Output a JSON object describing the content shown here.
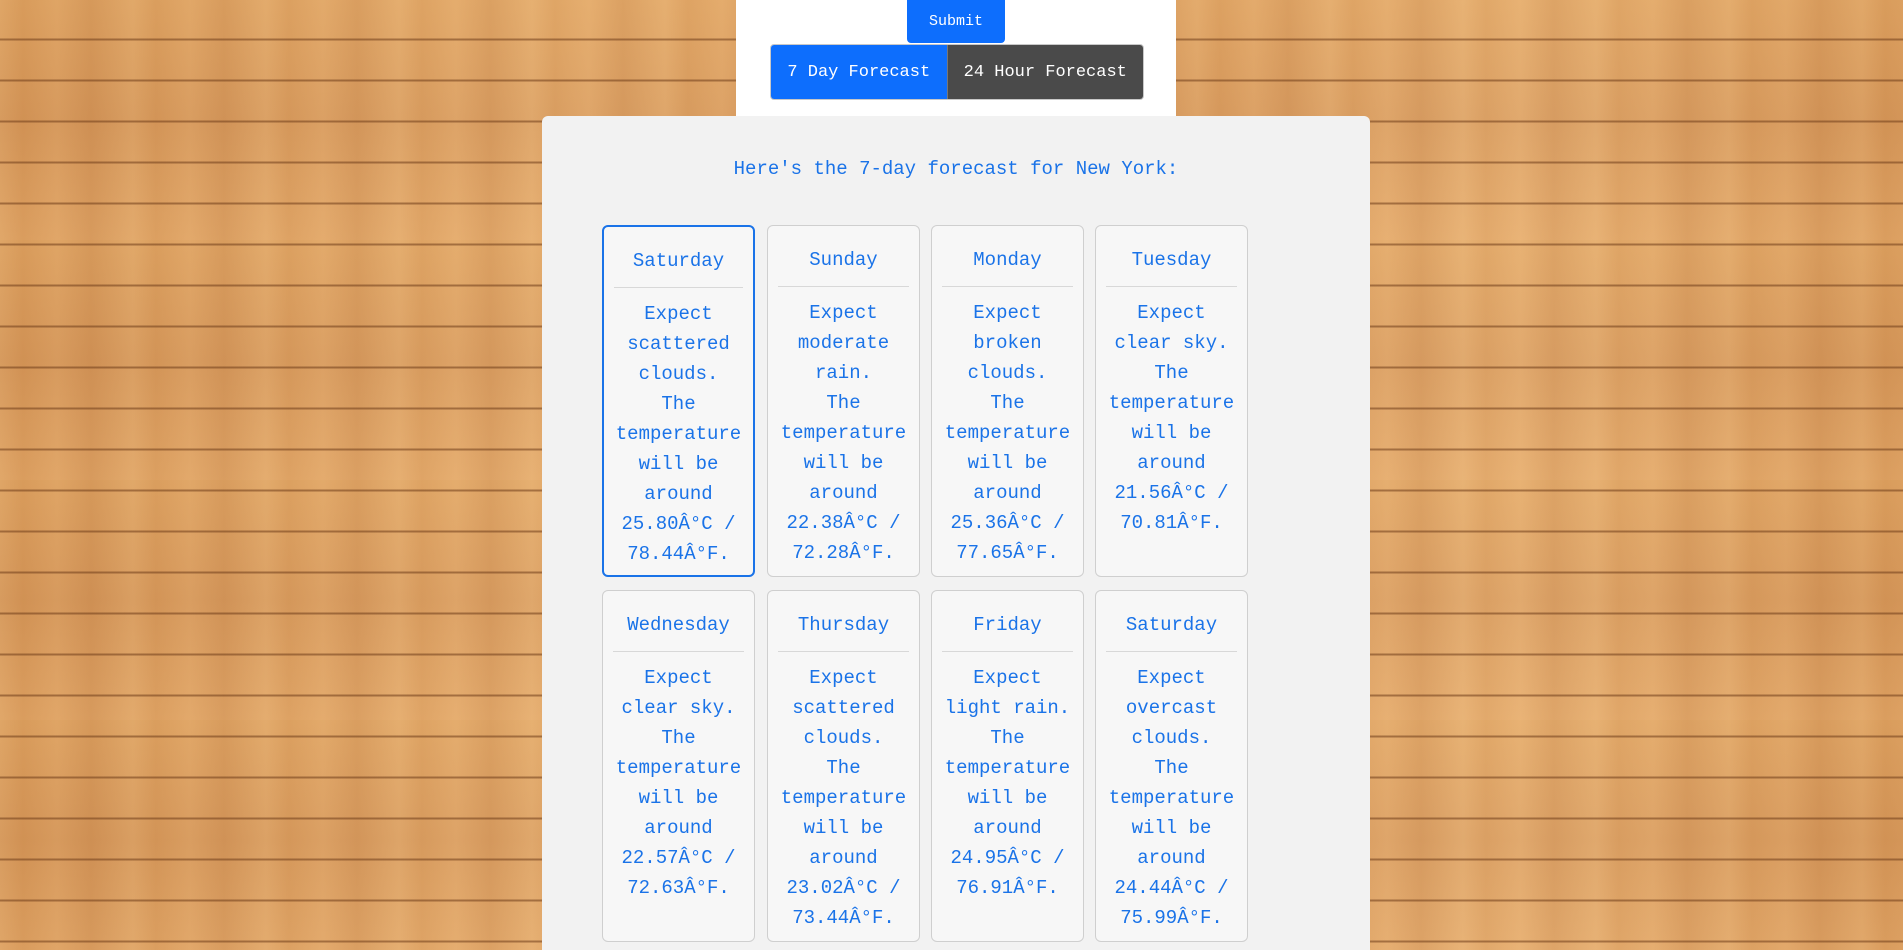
{
  "form": {
    "submit_label": "Submit"
  },
  "tabs": [
    {
      "label": "7 Day Forecast",
      "active": true
    },
    {
      "label": "24 Hour Forecast",
      "active": false
    }
  ],
  "forecast": {
    "heading": "Here's the 7-day forecast for New York:",
    "days": [
      {
        "day": "Saturday",
        "lines": [
          "Expect",
          "scattered",
          "clouds.",
          "The",
          "temperature",
          "will be",
          "around",
          "25.80Â°C /",
          "78.44Â°F."
        ],
        "selected": true
      },
      {
        "day": "Sunday",
        "lines": [
          "Expect",
          "moderate",
          "rain.",
          "The",
          "temperature",
          "will be",
          "around",
          "22.38Â°C /",
          "72.28Â°F."
        ],
        "selected": false
      },
      {
        "day": "Monday",
        "lines": [
          "Expect",
          "broken",
          "clouds.",
          "The",
          "temperature",
          "will be",
          "around",
          "25.36Â°C /",
          "77.65Â°F."
        ],
        "selected": false
      },
      {
        "day": "Tuesday",
        "lines": [
          "Expect",
          "clear sky.",
          "The",
          "temperature",
          "will be",
          "around",
          "21.56Â°C /",
          "70.81Â°F."
        ],
        "selected": false
      },
      {
        "day": "Wednesday",
        "lines": [
          "Expect",
          "clear sky.",
          "The",
          "temperature",
          "will be",
          "around",
          "22.57Â°C /",
          "72.63Â°F."
        ],
        "selected": false
      },
      {
        "day": "Thursday",
        "lines": [
          "Expect",
          "scattered",
          "clouds.",
          "The",
          "temperature",
          "will be",
          "around",
          "23.02Â°C /",
          "73.44Â°F."
        ],
        "selected": false
      },
      {
        "day": "Friday",
        "lines": [
          "Expect",
          "light rain.",
          "The",
          "temperature",
          "will be",
          "around",
          "24.95Â°C /",
          "76.91Â°F."
        ],
        "selected": false
      },
      {
        "day": "Saturday",
        "lines": [
          "Expect",
          "overcast",
          "clouds.",
          "The",
          "temperature",
          "will be",
          "around",
          "24.44Â°C /",
          "75.99Â°F."
        ],
        "selected": false
      }
    ]
  },
  "colors": {
    "accent": "#0d6efd",
    "text_blue": "#1a73e8",
    "inactive_tab": "#4a4a4a",
    "panel_bg": "#f2f2f2"
  }
}
